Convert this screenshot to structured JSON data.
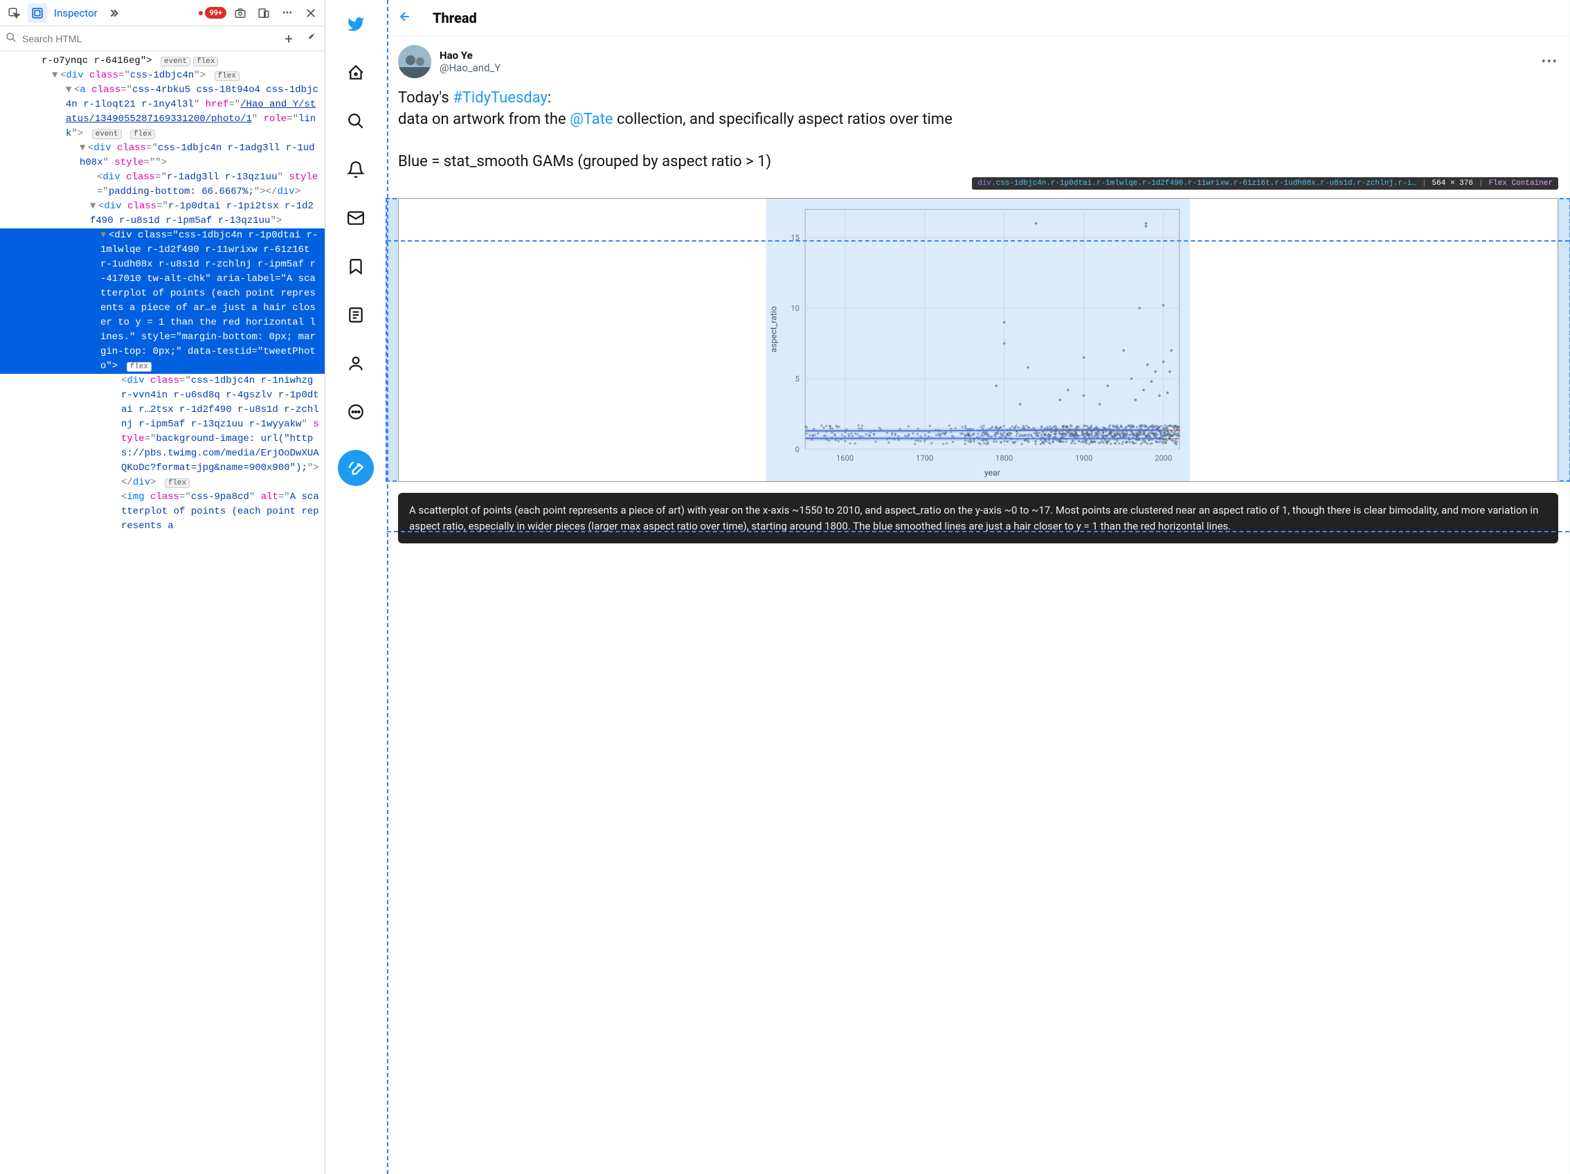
{
  "devtools": {
    "inspector_label": "Inspector",
    "errors_badge": "99+",
    "search_placeholder": "Search HTML",
    "tree": {
      "line0": "r-o7ynqc r-6416eg\">",
      "line0_badges": [
        "event",
        "flex"
      ],
      "line1_open": "<",
      "line1_tag": "div",
      "line1_class_attr": "class",
      "line1_class_val": "css-1dbjc4n",
      "line1_close": ">",
      "flex_badge": "flex",
      "a_tag": "a",
      "a_class": "css-4rbku5 css-18t94o4 css-1dbjc4n r-1loqt21 r-1ny4l3l",
      "a_href": "/Hao_and_Y/status/1349055287169331200/photo/1",
      "a_role": "link",
      "event_badge": "event",
      "div2_class": "css-1dbjc4n r-1adg3ll r-1udh08x",
      "div2_style_attr": "style",
      "div3_class": "r-1adg3ll r-13qz1uu",
      "div3_style": "padding-bottom: 66.6667%;",
      "div4_class": "r-1p0dtai r-1pi2tsx r-1d2f490 r-u8s1d r-ipm5af r-13qz1uu",
      "sel_class": "css-1dbjc4n r-1p0dtai r-1mlwlqe r-1d2f490 r-11wrixw r-61z16t r-1udh08x r-u8s1d r-zchlnj r-ipm5af r-417010 tw-alt-chk",
      "sel_aria": "A scatterplot of points (each point represents a piece of ar…e just a hair closer to y = 1 than the red horizontal lines.",
      "sel_style": "margin-bottom: 0px; margin-top: 0px;",
      "sel_testid": "tweetPhoto",
      "div6_class": "css-1dbjc4n r-1niwhzg r-vvn4in r-u6sd8q r-4gszlv r-1p0dtai r…2tsx r-1d2f490 r-u8s1d r-zchlnj r-ipm5af r-13qz1uu r-1wyyakw",
      "div6_style": "background-image: url(\"https://pbs.twimg.com/media/ErjOoDwXUAQKoDc?format=jpg&name=900x900\");",
      "img_tag": "img",
      "img_class": "css-9pa8cd",
      "img_alt": "A scatterplot of points (each point represents a"
    }
  },
  "twitter": {
    "thread_title": "Thread",
    "user_name": "Hao Ye",
    "user_handle": "@Hao_and_Y",
    "body_today": "Today's ",
    "body_hashtag": "#TidyTuesday",
    "body_colon": ":",
    "body_line2a": "data on artwork from the ",
    "body_mention": "@Tate",
    "body_line2b": " collection, and specifically aspect ratios over time",
    "body_line3": "Blue = stat_smooth GAMs (grouped by aspect ratio > 1)",
    "overlay_path": "div",
    "overlay_classes": ".css-1dbjc4n.r-1p0dtai.r-1mlwlqe.r-1d2f490.r-11wrixw.r-61z16t.r-1udh08x.r-u8s1d.r-zchlnj.r-i…",
    "overlay_size": "564 × 376",
    "overlay_flex": "Flex Container",
    "alt_text": "A scatterplot of points (each point represents a piece of art) with year on the x-axis ~1550 to 2010, and aspect_ratio on the y-axis ~0 to ~17. Most points are clustered near an aspect ratio of 1, though there is clear bimodality, and more variation in aspect ratio, especially in wider pieces (larger max aspect ratio over time), starting around 1800. The blue smoothed lines are just a hair closer to y = 1 than the red horizontal lines."
  },
  "chart_data": {
    "type": "scatter",
    "title": "",
    "xlabel": "year",
    "ylabel": "aspect_ratio",
    "xlim": [
      1550,
      2020
    ],
    "ylim": [
      0,
      17
    ],
    "xticks": [
      1600,
      1700,
      1800,
      1900,
      2000
    ],
    "yticks": [
      0,
      5,
      10,
      15
    ],
    "hlines": [
      {
        "y": 0.75,
        "color": "#c0392b"
      },
      {
        "y": 1.33,
        "color": "#c0392b"
      }
    ],
    "smooth": [
      {
        "color": "#3b5fe8",
        "points": [
          [
            1550,
            1.3
          ],
          [
            1700,
            1.3
          ],
          [
            1800,
            1.35
          ],
          [
            1900,
            1.4
          ],
          [
            2000,
            1.35
          ]
        ]
      },
      {
        "color": "#3b5fe8",
        "points": [
          [
            1550,
            0.78
          ],
          [
            1700,
            0.78
          ],
          [
            1800,
            0.76
          ],
          [
            1900,
            0.75
          ],
          [
            2000,
            0.78
          ]
        ]
      }
    ],
    "cluster_note": "dense cluster of ~thousands of points between y=0.4 and y=1.8 spanning full x range, density increases after 1800; scattered outliers above y=3 mostly after 1800",
    "outliers": [
      [
        1790,
        4.5
      ],
      [
        1800,
        7.5
      ],
      [
        1800,
        9
      ],
      [
        1820,
        3.2
      ],
      [
        1830,
        5.8
      ],
      [
        1840,
        16
      ],
      [
        1870,
        3.5
      ],
      [
        1880,
        4.2
      ],
      [
        1900,
        6.5
      ],
      [
        1900,
        3.8
      ],
      [
        1920,
        3.2
      ],
      [
        1930,
        4.5
      ],
      [
        1950,
        7
      ],
      [
        1960,
        5
      ],
      [
        1965,
        3.5
      ],
      [
        1970,
        10
      ],
      [
        1975,
        4.2
      ],
      [
        1978,
        16
      ],
      [
        1978,
        15.8
      ],
      [
        1980,
        6
      ],
      [
        1985,
        4.8
      ],
      [
        1990,
        5.5
      ],
      [
        1995,
        3.8
      ],
      [
        2000,
        6.2
      ],
      [
        2000,
        10.2
      ],
      [
        2005,
        4
      ],
      [
        2008,
        5.5
      ],
      [
        2010,
        7
      ]
    ]
  }
}
